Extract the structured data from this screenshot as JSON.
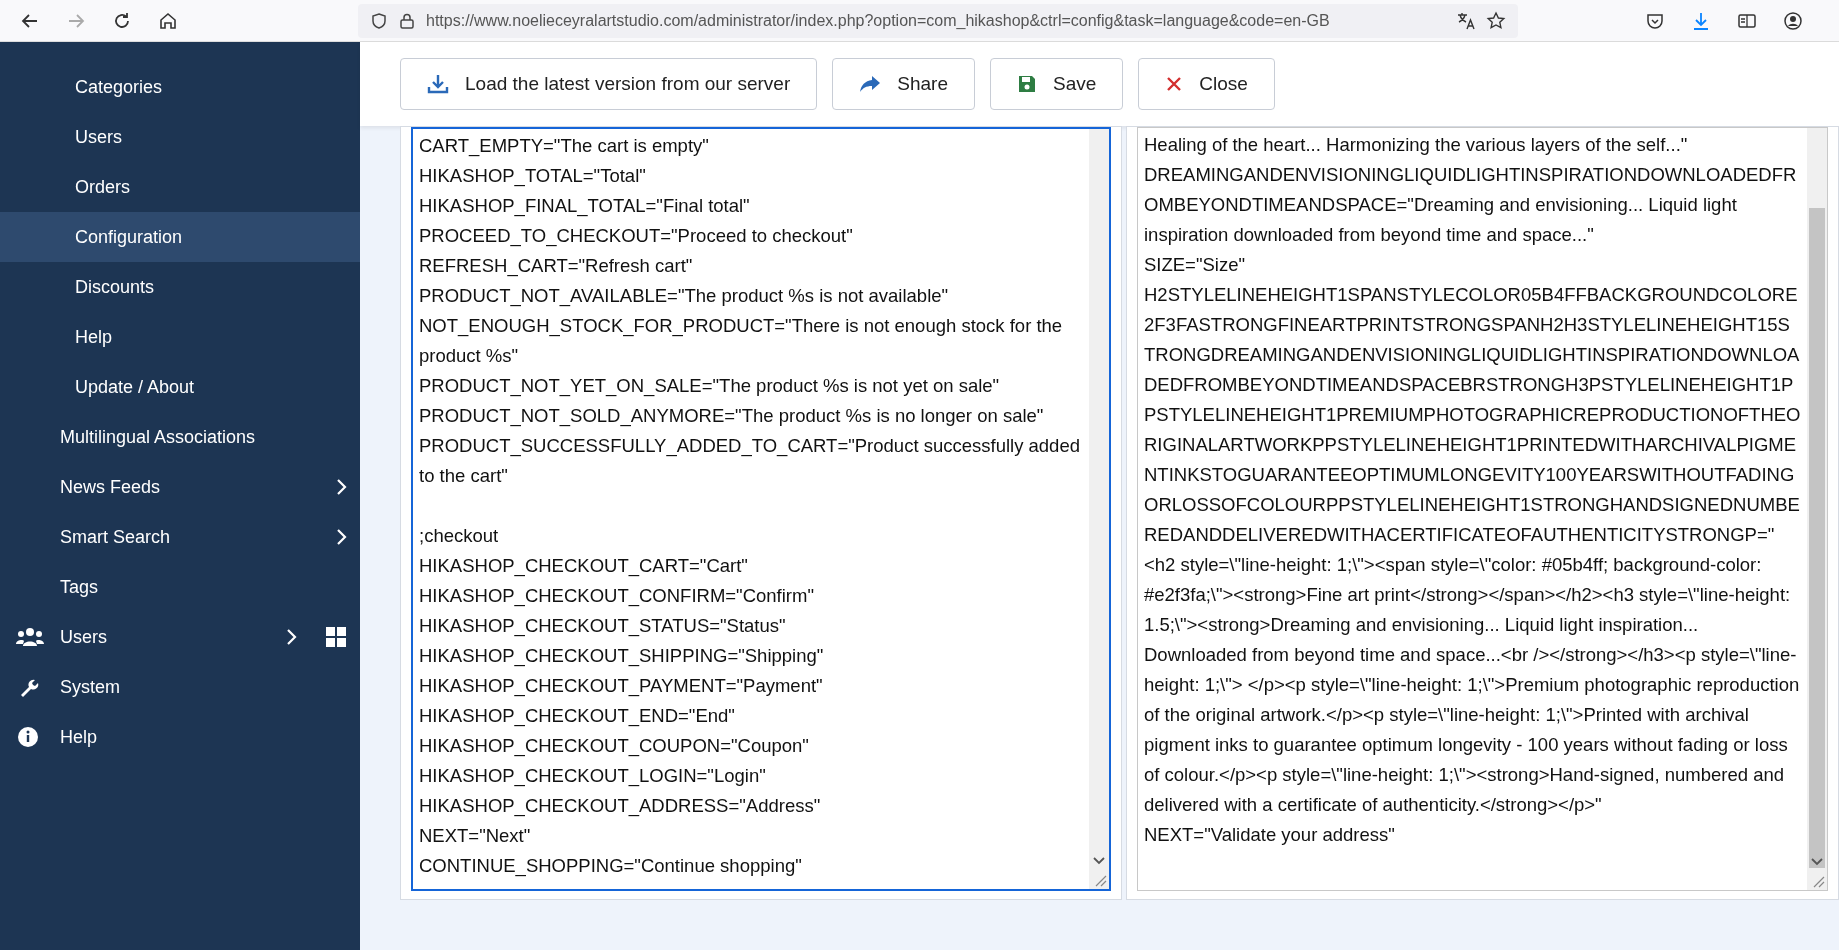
{
  "browser": {
    "address": "https://www.noelieceyralartstudio.com/administrator/index.php?option=com_hikashop&ctrl=config&task=language&code=en-GB",
    "forward_disabled": true
  },
  "sidebar": {
    "submenu": [
      {
        "label": "Categories",
        "selected": false
      },
      {
        "label": "Users",
        "selected": false
      },
      {
        "label": "Orders",
        "selected": false
      },
      {
        "label": "Configuration",
        "selected": true
      },
      {
        "label": "Discounts",
        "selected": false
      },
      {
        "label": "Help",
        "selected": false
      },
      {
        "label": "Update / About",
        "selected": false
      }
    ],
    "components": [
      {
        "label": "Multilingual Associations",
        "expandable": false
      },
      {
        "label": "News Feeds",
        "expandable": true
      },
      {
        "label": "Smart Search",
        "expandable": true
      },
      {
        "label": "Tags",
        "expandable": false
      }
    ],
    "main_menu": [
      {
        "label": "Users",
        "expandable": true,
        "dashboard_link": true
      },
      {
        "label": "System",
        "expandable": false,
        "dashboard_link": false
      },
      {
        "label": "Help",
        "expandable": false,
        "dashboard_link": false
      }
    ]
  },
  "toolbar": [
    {
      "kind": "download",
      "label": "Load the latest version from our server"
    },
    {
      "kind": "share",
      "label": "Share"
    },
    {
      "kind": "save",
      "label": "Save"
    },
    {
      "kind": "close",
      "label": "Close"
    }
  ],
  "editors": [
    {
      "focused": true,
      "sections": [
        [
          "CART_EMPTY=\"The cart is empty\"",
          "HIKASHOP_TOTAL=\"Total\"",
          "HIKASHOP_FINAL_TOTAL=\"Final total\"",
          "PROCEED_TO_CHECKOUT=\"Proceed to checkout\"",
          "REFRESH_CART=\"Refresh cart\"",
          "PRODUCT_NOT_AVAILABLE=\"The product %s is not available\"",
          "NOT_ENOUGH_STOCK_FOR_PRODUCT=\"There is not enough stock for the product %s\"",
          "PRODUCT_NOT_YET_ON_SALE=\"The product %s is not yet on sale\"",
          "PRODUCT_NOT_SOLD_ANYMORE=\"The product %s is no longer on sale\"",
          "PRODUCT_SUCCESSFULLY_ADDED_TO_CART=\"Product successfully added to the cart\""
        ],
        [
          ";checkout",
          "HIKASHOP_CHECKOUT_CART=\"Cart\"",
          "HIKASHOP_CHECKOUT_CONFIRM=\"Confirm\"",
          "HIKASHOP_CHECKOUT_STATUS=\"Status\"",
          "HIKASHOP_CHECKOUT_SHIPPING=\"Shipping\"",
          "HIKASHOP_CHECKOUT_PAYMENT=\"Payment\"",
          "HIKASHOP_CHECKOUT_END=\"End\"",
          "HIKASHOP_CHECKOUT_COUPON=\"Coupon\"",
          "HIKASHOP_CHECKOUT_LOGIN=\"Login\"",
          "HIKASHOP_CHECKOUT_ADDRESS=\"Address\"",
          "NEXT=\"Next\"",
          "CONTINUE_SHOPPING=\"Continue shopping\""
        ]
      ]
    },
    {
      "focused": false,
      "sections": [
        [
          "Healing of the heart... Harmonizing the various layers of the self...\"",
          "DREAMINGANDENVISIONINGLIQUIDLIGHTINSPIRATIONDOWNLOADEDFROMBEYONDTIMEANDSPACE=\"Dreaming and envisioning... Liquid light inspiration downloaded from beyond time and space...\"",
          "SIZE=\"Size\"",
          "H2STYLELINEHEIGHT1SPANSTYLECOLOR05B4FFBACKGROUNDCOLORE2F3FASTRONGFINEARTPRINTSTRONGSPANH2H3STYLELINEHEIGHT15STRONGDREAMINGANDENVISIONINGLIQUIDLIGHTINSPIRATIONDOWNLOADEDFROMBEYONDTIMEANDSPACEBRSTRONGH3PSTYLELINEHEIGHT1PPSTYLELINEHEIGHT1PREMIUMPHOTOGRAPHICREPRODUCTIONOFTHEORIGINALARTWORKPPSTYLELINEHEIGHT1PRINTEDWITHARCHIVALPIGMENTINKSTOGUARANTEEOPTIMUMLONGEVITY100YEARSWITHOUTFADINGORLOSSOFCOLOURPPSTYLELINEHEIGHT1STRONGHANDSIGNEDNUMBEREDANDDELIVEREDWITHACERTIFICATEOFAUTHENTICITYSTRONGP=\"<h2 style=\\\"line-height: 1;\\\"><span style=\\\"color: #05b4ff; background-color: #e2f3fa;\\\"><strong>Fine art print</strong></span></h2><h3 style=\\\"line-height: 1.5;\\\"><strong>Dreaming and envisioning... Liquid light inspiration... Downloaded from beyond time and space...<br /></strong></h3><p style=\\\"line-height: 1;\\\"> </p><p style=\\\"line-height: 1;\\\">Premium photographic reproduction of the original artwork.</p><p style=\\\"line-height: 1;\\\">Printed with archival pigment inks to guarantee optimum longevity - 100 years without fading or loss of colour.</p><p style=\\\"line-height: 1;\\\"><strong>Hand-signed, numbered and delivered with a certificate of authenticity.</strong></p>\"",
          "NEXT=\"Validate your address\""
        ]
      ]
    }
  ]
}
